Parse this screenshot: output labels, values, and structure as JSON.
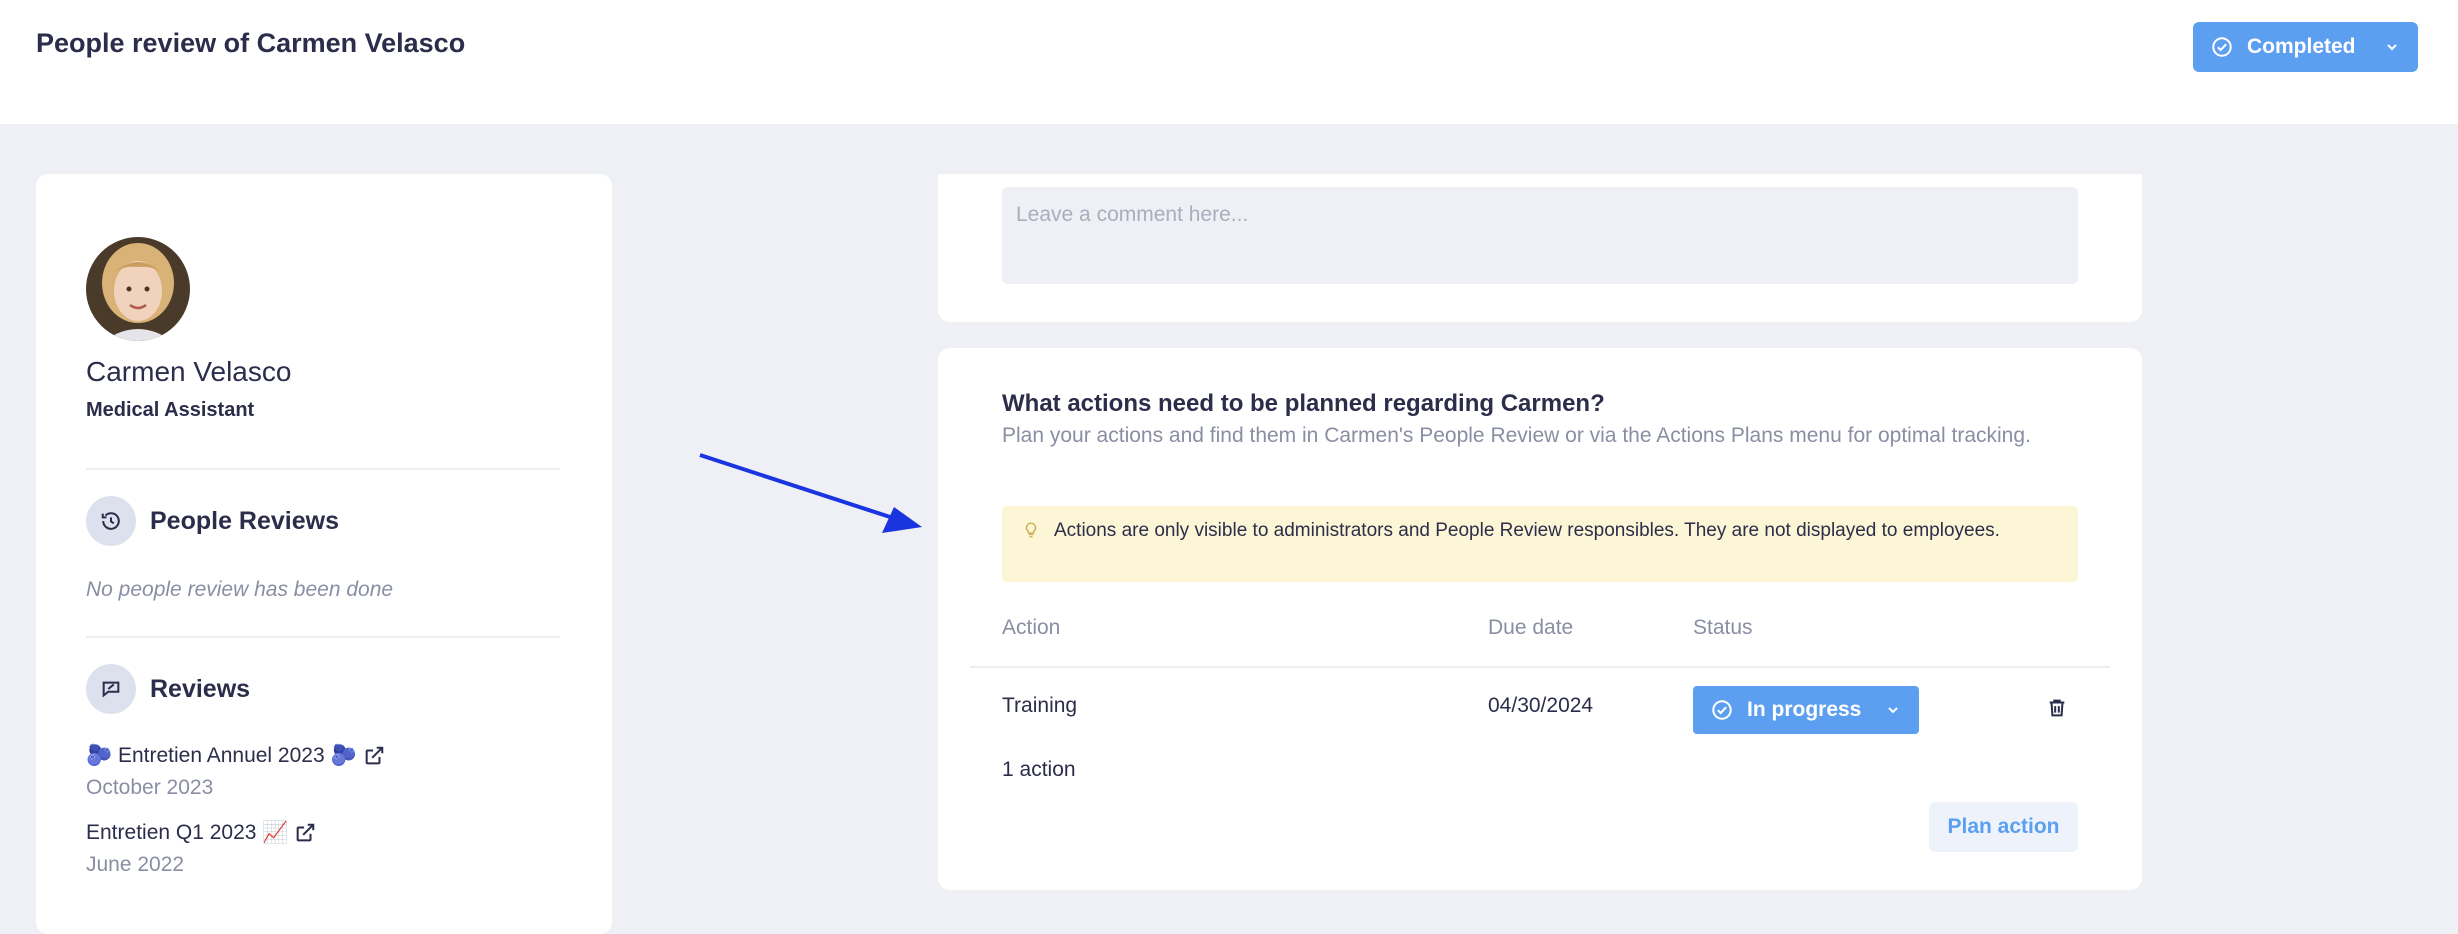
{
  "header": {
    "title": "People review of Carmen Velasco",
    "status_label": "Completed"
  },
  "profile": {
    "name": "Carmen Velasco",
    "role": "Medical Assistant"
  },
  "people_reviews": {
    "title": "People Reviews",
    "empty_text": "No people review has been done"
  },
  "reviews": {
    "title": "Reviews",
    "items": [
      {
        "title": "🫐 Entretien Annuel 2023 🫐",
        "date": "October 2023"
      },
      {
        "title": "Entretien Q1 2023 📈",
        "date": "June 2022"
      }
    ]
  },
  "comment": {
    "placeholder": "Leave a comment here..."
  },
  "actions": {
    "title": "What actions need to be planned regarding Carmen?",
    "description": "Plan your actions and find them in Carmen's People Review or via the Actions Plans menu for optimal tracking.",
    "info": "Actions are only visible to administrators and People Review responsibles. They are not displayed to employees.",
    "columns": {
      "action": "Action",
      "due_date": "Due date",
      "status": "Status"
    },
    "rows": [
      {
        "action": "Training",
        "due_date": "04/30/2024",
        "status": "In progress"
      }
    ],
    "count_label": "1 action",
    "plan_button": "Plan action"
  },
  "colors": {
    "accent": "#5c9ff0",
    "info_bg": "#fdf6d6",
    "arrow": "#1a35e0"
  }
}
